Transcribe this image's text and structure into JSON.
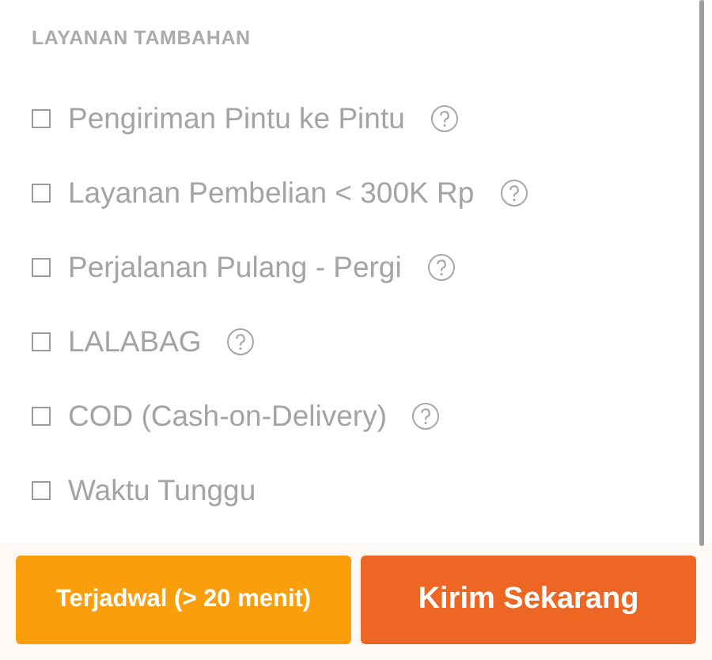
{
  "section_title": "LAYANAN TAMBAHAN",
  "services": [
    {
      "label": "Pengiriman Pintu ke Pintu",
      "checked": false,
      "help": true
    },
    {
      "label": "Layanan Pembelian < 300K Rp",
      "checked": false,
      "help": true
    },
    {
      "label": "Perjalanan Pulang - Pergi",
      "checked": false,
      "help": true
    },
    {
      "label": "LALABAG",
      "checked": false,
      "help": true
    },
    {
      "label": "COD (Cash-on-Delivery)",
      "checked": false,
      "help": true
    },
    {
      "label": "Waktu Tunggu",
      "checked": false,
      "help": false
    }
  ],
  "buttons": [
    {
      "label": "Terjadwal (> 20 menit)",
      "kind": "secondary"
    },
    {
      "label": "Kirim Sekarang",
      "kind": "primary"
    }
  ]
}
